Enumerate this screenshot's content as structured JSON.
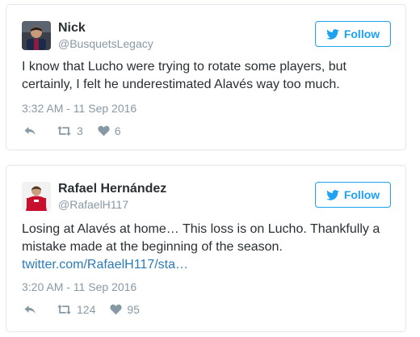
{
  "tweets": [
    {
      "display_name": "Nick",
      "handle": "@BusquetsLegacy",
      "follow_label": "Follow",
      "text": "I know that Lucho were trying to rotate some players, but certainly, I felt he underestimated Alavés way too much.",
      "timestamp": "3:32 AM - 11 Sep 2016",
      "retweets": "3",
      "likes": "6"
    },
    {
      "display_name": "Rafael Hernández",
      "handle": "@RafaelH117",
      "follow_label": "Follow",
      "text": "Losing at Alavés at home… This loss is on Lucho. Thankfully a mistake made at the beginning of the season.",
      "link": "twitter.com/RafaelH117/sta…",
      "timestamp": "3:20 AM - 11 Sep 2016",
      "retweets": "124",
      "likes": "95"
    }
  ],
  "colors": {
    "twitter_blue": "#1da1f2",
    "text": "#292f33",
    "muted": "#8899a6",
    "link": "#2b7bb9",
    "border": "#e1e8ed"
  },
  "icons": {
    "follow": "twitter-bird-icon",
    "reply": "reply-icon",
    "retweet": "retweet-icon",
    "like": "heart-icon"
  }
}
